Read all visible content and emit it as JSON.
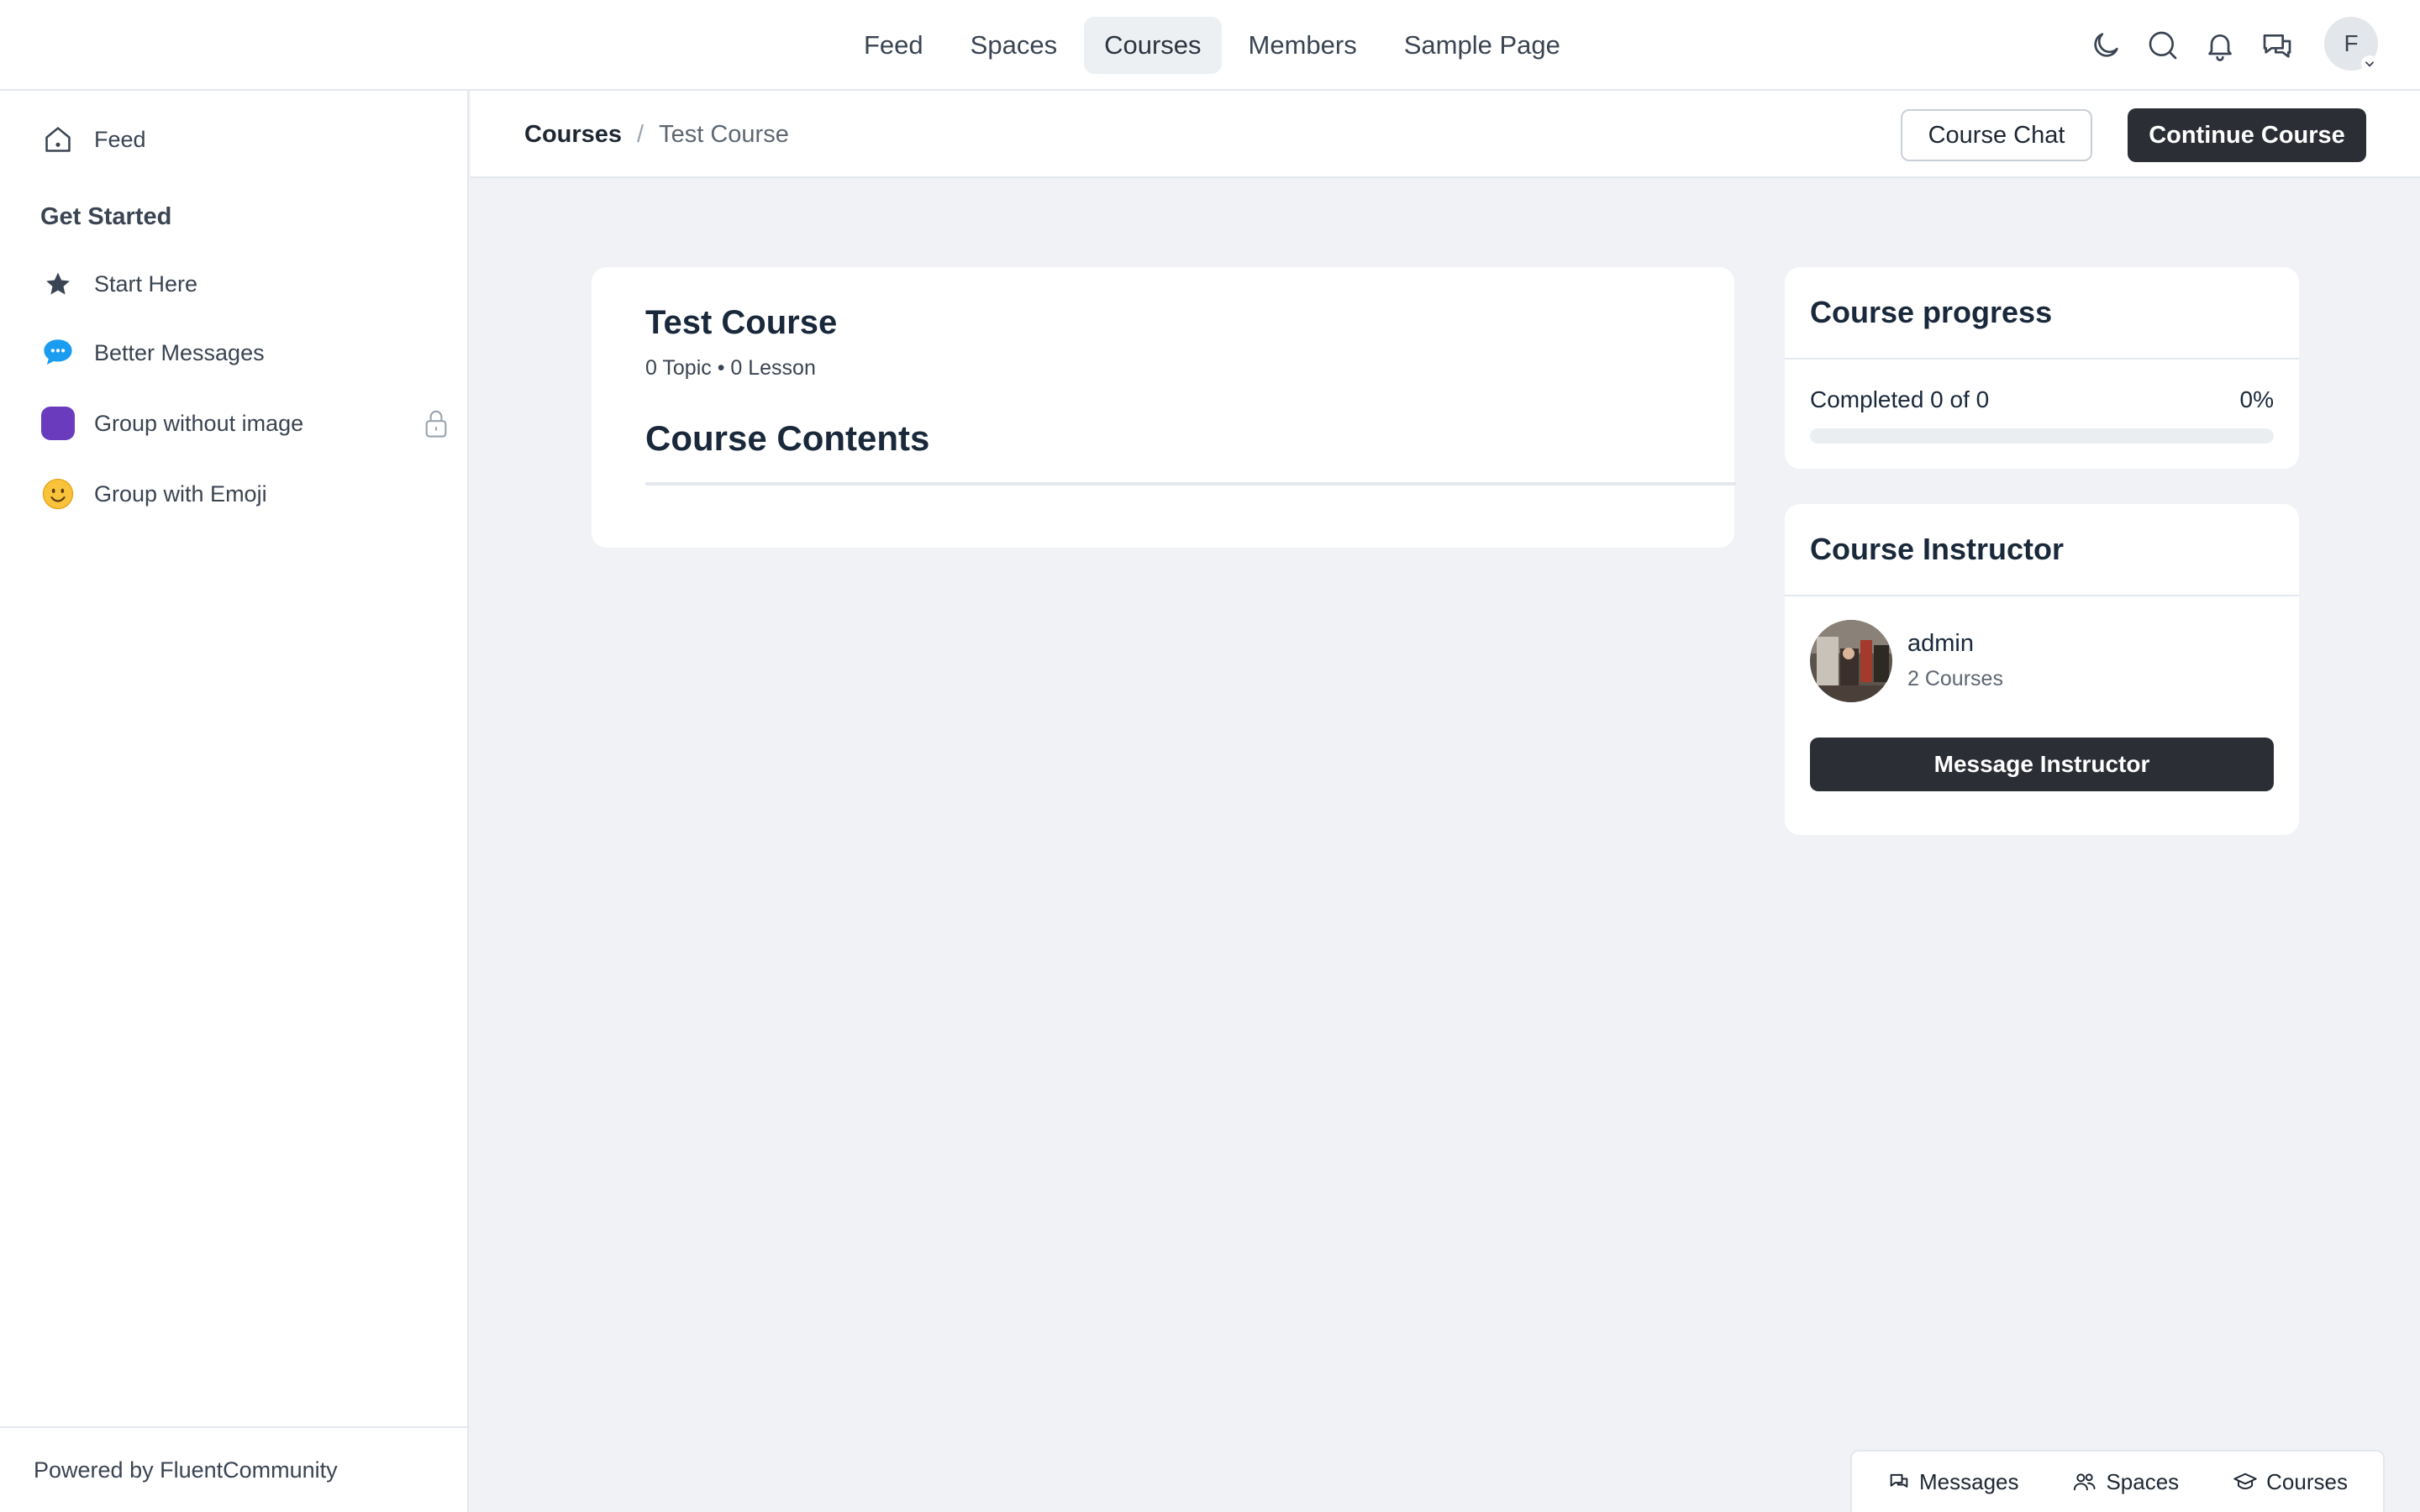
{
  "topnav": {
    "items": [
      {
        "label": "Feed",
        "active": false
      },
      {
        "label": "Spaces",
        "active": false
      },
      {
        "label": "Courses",
        "active": true
      },
      {
        "label": "Members",
        "active": false
      },
      {
        "label": "Sample Page",
        "active": false
      }
    ],
    "icons": [
      "moon-icon",
      "search-icon",
      "bell-icon",
      "chat-bubbles-icon"
    ],
    "user_initial": "F"
  },
  "sidebar": {
    "feed_label": "Feed",
    "section_heading": "Get Started",
    "items": [
      {
        "label": "Start Here",
        "icon": "star-icon"
      },
      {
        "label": "Better Messages",
        "icon": "messages-bubble-icon"
      },
      {
        "label": "Group without image",
        "icon": "purple-square-icon",
        "locked": true
      },
      {
        "label": "Group with Emoji",
        "icon": "smiley-emoji-icon",
        "emoji": "🙂"
      }
    ],
    "footer": "Powered by FluentCommunity"
  },
  "subheader": {
    "breadcrumb_root": "Courses",
    "breadcrumb_sep": "/",
    "breadcrumb_current": "Test Course",
    "course_chat_label": "Course Chat",
    "continue_label": "Continue Course"
  },
  "course": {
    "title": "Test Course",
    "meta": "0 Topic • 0 Lesson",
    "contents_heading": "Course Contents"
  },
  "progress": {
    "title": "Course progress",
    "completed_text": "Completed 0 of 0",
    "percent_text": "0%",
    "percent_value": 0
  },
  "instructor": {
    "title": "Course Instructor",
    "name": "admin",
    "courses": "2 Courses",
    "message_label": "Message Instructor"
  },
  "bottom_bar": {
    "items": [
      {
        "label": "Messages",
        "icon": "messages-icon"
      },
      {
        "label": "Spaces",
        "icon": "users-icon"
      },
      {
        "label": "Courses",
        "icon": "graduation-cap-icon"
      }
    ]
  },
  "colors": {
    "background": "#f0f2f5",
    "dark_button": "#2b2e34",
    "purple_group": "#6a3cbd",
    "messages_blue": "#1a9cf0"
  }
}
